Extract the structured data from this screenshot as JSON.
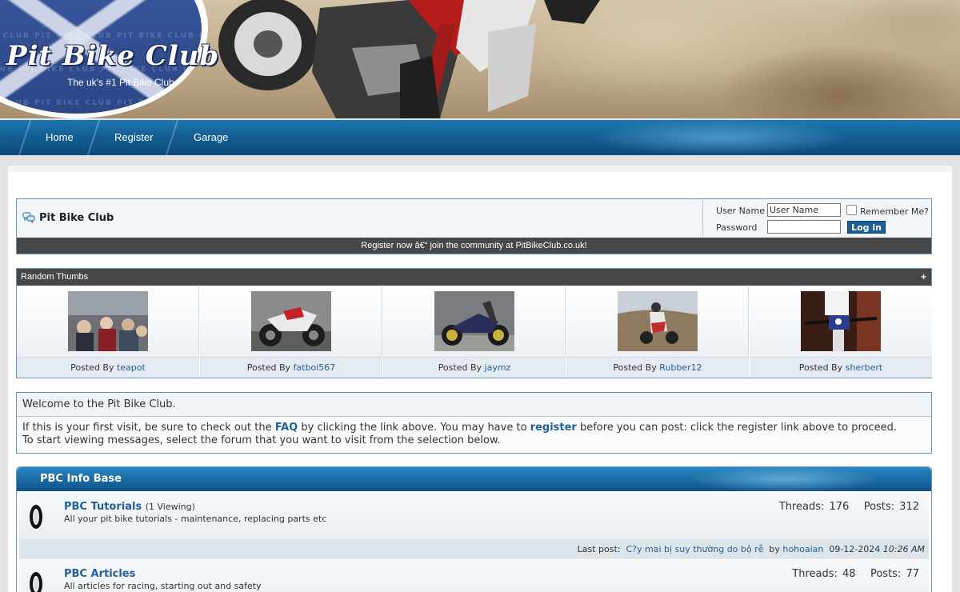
{
  "header": {
    "logo_title": "Pit Bike Club",
    "logo_tagline": "The uk's #1 Pit Bike Club",
    "logo_watermark": "PIT BIKE CLUB  PIT BIKE CLUB  PIT BIKE CLUB  PIT BIKE CLUB"
  },
  "nav": {
    "items": [
      {
        "label": "Home"
      },
      {
        "label": "Register"
      },
      {
        "label": "Garage"
      }
    ]
  },
  "site": {
    "title": "Pit Bike Club"
  },
  "login": {
    "username_label": "User Name",
    "username_value": "User Name",
    "password_label": "Password",
    "remember_label": "Remember Me?",
    "button_label": "Log in"
  },
  "announcement": "Register now â€“ join the community at PitBikeClub.co.uk!",
  "random_thumbs": {
    "title": "Random Thumbs",
    "toggle": "+",
    "posted_by_label": "Posted By",
    "items": [
      {
        "user": "teapot"
      },
      {
        "user": "fatboi567"
      },
      {
        "user": "jaymz"
      },
      {
        "user": "Rubber12"
      },
      {
        "user": "sherbert"
      }
    ]
  },
  "welcome": {
    "heading": "Welcome to the Pit Bike Club.",
    "text_1": "If this is your first visit, be sure to check out the ",
    "faq_link": "FAQ",
    "text_2": " by clicking the link above. You may have to ",
    "register_link": "register",
    "text_3": " before you can post: click the register link above to proceed. To start viewing messages, select the forum that you want to visit from the selection below."
  },
  "forum_category": {
    "title": "PBC Info Base",
    "forums": [
      {
        "name": "PBC Tutorials",
        "viewing": "(1 Viewing)",
        "description": "All your pit bike tutorials - maintenance, replacing parts etc",
        "stats": "Threads: 176   Posts: 312",
        "last_post": {
          "label": "Last post:",
          "title": "C?y mai bị suy thường do bộ rễ",
          "by": "by",
          "user": "hohoaian",
          "date": "09-12-2024",
          "time": "10:26 AM"
        }
      },
      {
        "name": "PBC Articles",
        "viewing": "",
        "description": "All articles for racing, starting out and safety",
        "stats": "Threads: 48   Posts: 77"
      }
    ]
  },
  "colors": {
    "nav_blue": "#145f95",
    "link_blue": "#22609b",
    "bar_dark": "#474747",
    "border_blue": "#6a95b5"
  }
}
